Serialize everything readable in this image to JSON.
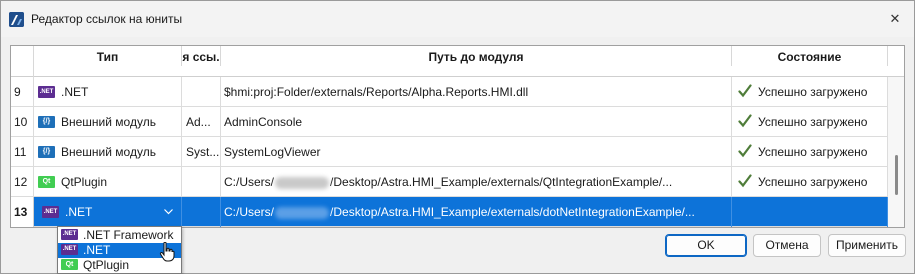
{
  "window": {
    "title": "Редактор ссылок на юниты",
    "close_glyph": "✕"
  },
  "grid": {
    "columns": {
      "type": "Тип",
      "link": "я ссы.",
      "path": "Путь до модуля",
      "state": "Состояние"
    },
    "rows": [
      {
        "num": "9",
        "type_badge": ".NET",
        "type": ".NET",
        "link": "",
        "path": "$hmi:proj:Folder/externals/Reports/Alpha.Reports.HMI.dll",
        "status": "Успешно загружено"
      },
      {
        "num": "10",
        "type_badge": "{/}",
        "type": "Внешний модуль",
        "link": "Ad...",
        "path": "AdminConsole",
        "status": "Успешно загружено"
      },
      {
        "num": "11",
        "type_badge": "{/}",
        "type": "Внешний модуль",
        "link": "Syst...",
        "path": "SystemLogViewer",
        "status": "Успешно загружено"
      },
      {
        "num": "12",
        "type_badge": "Qt",
        "type": "QtPlugin",
        "link": "",
        "path_prefix": "C:/Users/",
        "path_suffix": "/Desktop/Astra.HMI_Example/externals/QtIntegrationExample/...",
        "status": "Успешно загружено"
      },
      {
        "num": "13",
        "type_badge": ".NET",
        "type": ".NET",
        "link": "",
        "path_prefix": "C:/Users/",
        "path_suffix": "/Desktop/Astra.HMI_Example/externals/dotNetIntegrationExample/...",
        "status": ""
      }
    ],
    "selected_row": "13"
  },
  "dropdown": {
    "options": [
      {
        "badge": ".NET",
        "label": ".NET Framework"
      },
      {
        "badge": ".NET",
        "label": ".NET"
      },
      {
        "badge": "Qt",
        "label": "QtPlugin"
      }
    ],
    "highlighted": ".NET"
  },
  "buttons": {
    "ok": "OK",
    "cancel": "Отмена",
    "apply": "Применить"
  },
  "colors": {
    "selection": "#0d73d9",
    "net_badge": "#5c2d91",
    "ext_badge": "#1e6fb8",
    "qt_badge": "#41cd52",
    "check": "#4f7d3a"
  }
}
